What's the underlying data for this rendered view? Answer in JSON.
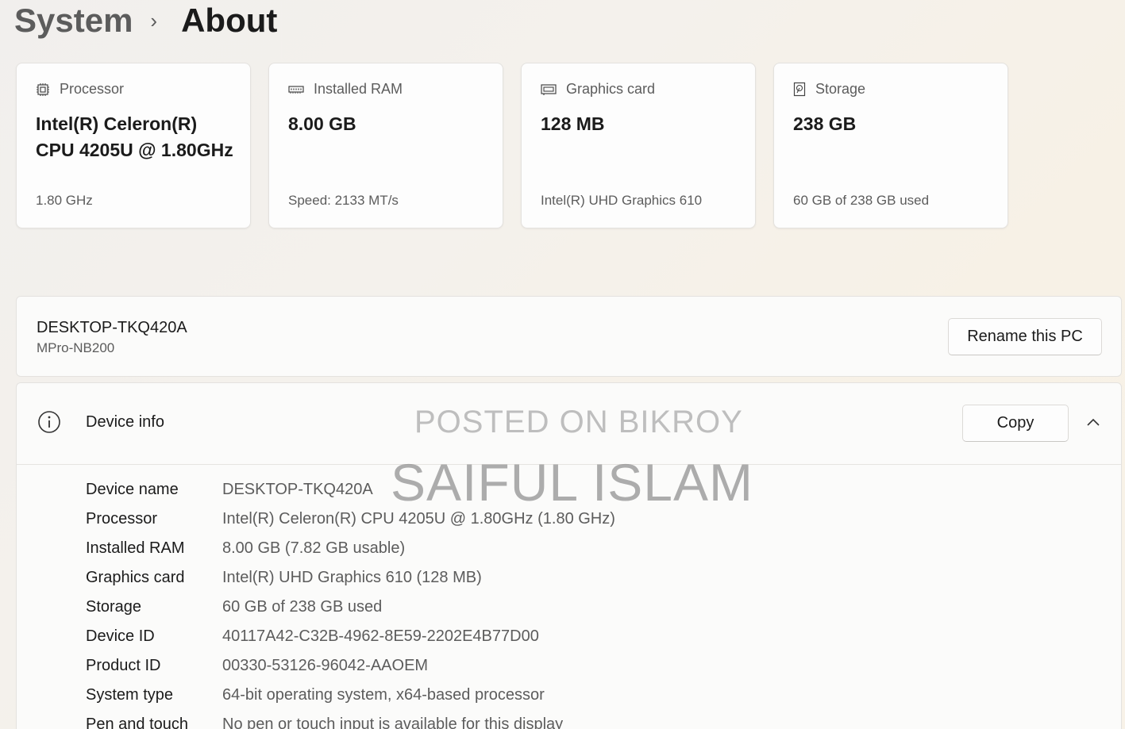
{
  "breadcrumb": {
    "parent": "System",
    "separator": "›",
    "current": "About"
  },
  "cards": [
    {
      "icon": "processor-icon",
      "label": "Processor",
      "value": "Intel(R) Celeron(R) CPU 4205U @ 1.80GHz",
      "sub": "1.80 GHz"
    },
    {
      "icon": "ram-icon",
      "label": "Installed RAM",
      "value": "8.00 GB",
      "sub": "Speed: 2133 MT/s"
    },
    {
      "icon": "graphics-card-icon",
      "label": "Graphics card",
      "value": "128 MB",
      "sub": "Intel(R) UHD Graphics 610"
    },
    {
      "icon": "storage-icon",
      "label": "Storage",
      "value": "238 GB",
      "sub": "60 GB of 238 GB used"
    }
  ],
  "pc": {
    "name": "DESKTOP-TKQ420A",
    "model": "MPro-NB200",
    "rename_label": "Rename this PC"
  },
  "device_info": {
    "title": "Device info",
    "copy_label": "Copy",
    "rows": [
      {
        "label": "Device name",
        "value": "DESKTOP-TKQ420A"
      },
      {
        "label": "Processor",
        "value": "Intel(R) Celeron(R) CPU 4205U @ 1.80GHz (1.80 GHz)"
      },
      {
        "label": "Installed RAM",
        "value": "8.00 GB (7.82 GB usable)"
      },
      {
        "label": "Graphics card",
        "value": "Intel(R) UHD Graphics 610 (128 MB)"
      },
      {
        "label": "Storage",
        "value": "60 GB of 238 GB used"
      },
      {
        "label": "Device ID",
        "value": "40117A42-C32B-4962-8E59-2202E4B77D00"
      },
      {
        "label": "Product ID",
        "value": "00330-53126-96042-AAOEM"
      },
      {
        "label": "System type",
        "value": "64-bit operating system, x64-based processor"
      },
      {
        "label": "Pen and touch",
        "value": "No pen or touch input is available for this display"
      }
    ]
  },
  "watermark": {
    "line1": "POSTED ON BIKROY",
    "line2": "SAIFUL ISLAM"
  }
}
